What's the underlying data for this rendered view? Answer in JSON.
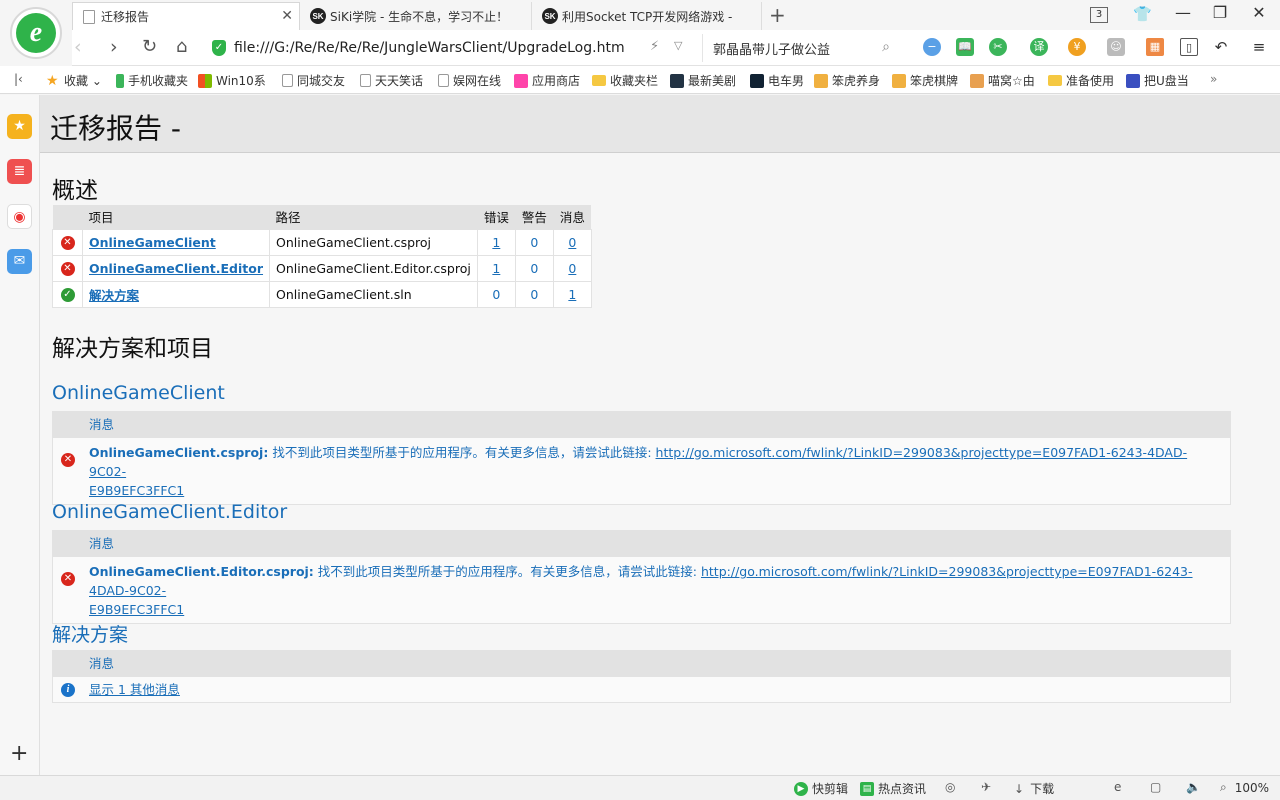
{
  "browser": {
    "tabs": [
      {
        "title": "迁移报告",
        "active": true
      },
      {
        "title": "SiKi学院 - 生命不息，学习不止！",
        "active": false
      },
      {
        "title": "利用Socket TCP开发网络游戏 -",
        "active": false
      }
    ],
    "tab_count": "3",
    "url": "file:///G:/Re/Re/Re/Re/JungleWarsClient/UpgradeLog.htm",
    "search_text": "郭晶晶带儿子做公益",
    "bookmarks": [
      {
        "label": "收藏",
        "icon": "star"
      },
      {
        "label": "手机收藏夹",
        "icon": "phone"
      },
      {
        "label": "Win10系",
        "icon": "windows"
      },
      {
        "label": "同城交友",
        "icon": "page"
      },
      {
        "label": "天天笑话",
        "icon": "page"
      },
      {
        "label": "娱网在线",
        "icon": "page"
      },
      {
        "label": "应用商店",
        "icon": "store"
      },
      {
        "label": "收藏夹栏",
        "icon": "folder"
      },
      {
        "label": "最新美剧",
        "icon": "tv"
      },
      {
        "label": "电车男",
        "icon": "tv"
      },
      {
        "label": "笨虎养身",
        "icon": "tiger"
      },
      {
        "label": "笨虎棋牌",
        "icon": "tiger"
      },
      {
        "label": "喵窝☆由",
        "icon": "paw"
      },
      {
        "label": "准备使用",
        "icon": "folder"
      },
      {
        "label": "把U盘当",
        "icon": "paw"
      }
    ],
    "bookmarks_more": "»"
  },
  "report": {
    "title": "迁移报告 -",
    "overview_heading": "概述",
    "columns": {
      "project": "项目",
      "path": "路径",
      "errors": "错误",
      "warnings": "警告",
      "messages": "消息"
    },
    "rows": [
      {
        "status": "error",
        "project": "OnlineGameClient",
        "path": "OnlineGameClient.csproj",
        "errors": "1",
        "warnings": "0",
        "messages": "0"
      },
      {
        "status": "error",
        "project": "OnlineGameClient.Editor",
        "path": "OnlineGameClient.Editor.csproj",
        "errors": "1",
        "warnings": "0",
        "messages": "0"
      },
      {
        "status": "ok",
        "project": "解决方案",
        "path": "OnlineGameClient.sln",
        "errors": "0",
        "warnings": "0",
        "messages": "1"
      }
    ],
    "section_heading": "解决方案和项目",
    "sections": [
      {
        "title": "OnlineGameClient",
        "header": "消息",
        "file": "OnlineGameClient.csproj:",
        "text": " 找不到此项目类型所基于的应用程序。有关更多信息，请尝试此链接: ",
        "link_a": "http://go.microsoft.com/fwlink/?LinkID=299083&projecttype=E097FAD1-6243-4DAD-9C02-",
        "link_b": "E9B9EFC3FFC1"
      },
      {
        "title": "OnlineGameClient.Editor",
        "header": "消息",
        "file": "OnlineGameClient.Editor.csproj:",
        "text": " 找不到此项目类型所基于的应用程序。有关更多信息，请尝试此链接: ",
        "link_a": "http://go.microsoft.com/fwlink/?LinkID=299083&projecttype=E097FAD1-6243-4DAD-9C02-",
        "link_b": "E9B9EFC3FFC1"
      },
      {
        "title": "解决方案",
        "header": "消息",
        "info_link": "显示 1 其他消息"
      }
    ]
  },
  "status": {
    "quick_cut": "快剪辑",
    "hot_news": "热点资讯",
    "download": "下载",
    "zoom": "100%"
  },
  "colors": {
    "accent": "#1a6eb8",
    "error": "#d8261c",
    "ok": "#2e9b36",
    "info": "#1a73c9",
    "brand": "#2fb34a"
  }
}
